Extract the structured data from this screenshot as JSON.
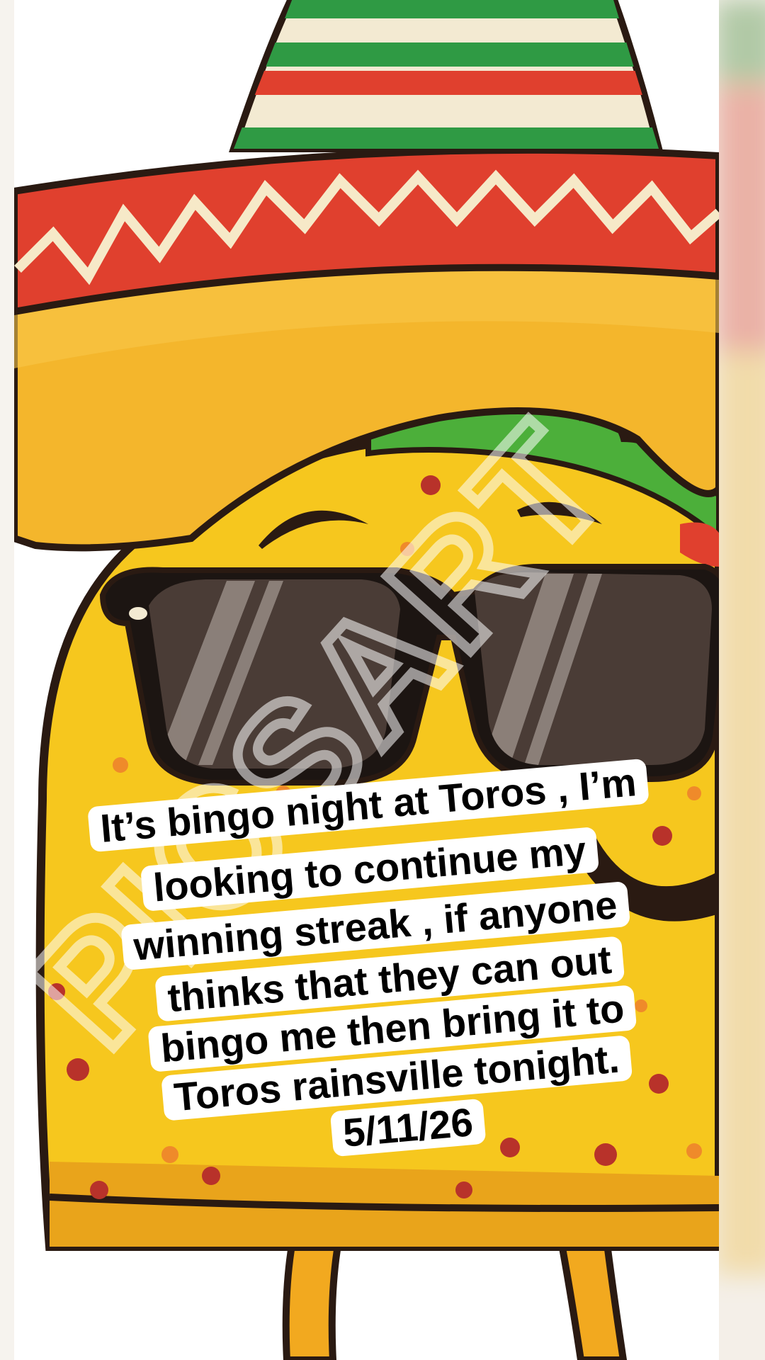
{
  "image": {
    "subject": "taco-character-with-sombrero-and-sunglasses",
    "icon": "taco-mascot-icon"
  },
  "watermark": {
    "text": "PICSART"
  },
  "caption": {
    "lines": [
      "It’s bingo night at Toros , I’m",
      "looking to continue my",
      "winning streak , if anyone",
      "thinks that they can out",
      "bingo me then bring it to",
      "Toros rainsville tonight.",
      "5/11/26"
    ]
  },
  "colors": {
    "taco_yellow": "#f6c71e",
    "sombrero_red": "#e0402e",
    "sombrero_green": "#2f9a44",
    "outline": "#2a1a12",
    "caption_bg": "#ffffff",
    "caption_text": "#000000"
  }
}
